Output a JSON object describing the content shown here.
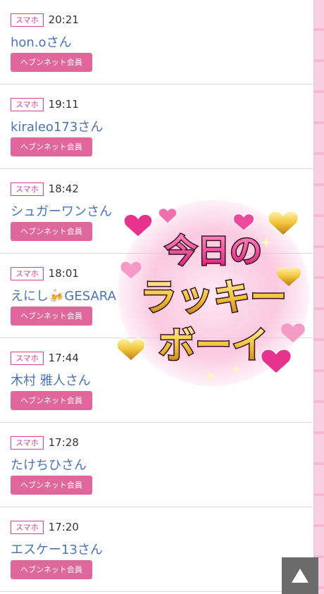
{
  "entries": [
    {
      "device": "スマホ",
      "time": "20:21",
      "name": "hon.oさん",
      "member_label": "ヘブンネット会員"
    },
    {
      "device": "スマホ",
      "time": "19:11",
      "name": "kiraleo173さん",
      "member_label": "ヘブンネット会員"
    },
    {
      "device": "スマホ",
      "time": "18:42",
      "name": "シュガーワンさん",
      "member_label": "ヘブンネット会員"
    },
    {
      "device": "スマホ",
      "time": "18:01",
      "name": "えにし🍻GESARA",
      "member_label": "ヘブンネット会員"
    },
    {
      "device": "スマホ",
      "time": "17:44",
      "name": "木村 雅人さん",
      "member_label": "ヘブンネット会員"
    },
    {
      "device": "スマホ",
      "time": "17:28",
      "name": "たけちひさん",
      "member_label": "ヘブンネット会員"
    },
    {
      "device": "スマホ",
      "time": "17:20",
      "name": "エスケー13さん",
      "member_label": "ヘブンネット会員"
    }
  ],
  "sticker": {
    "line1": "今日の",
    "line2": "ラッキー",
    "line3": "ボーイ"
  },
  "scroll_top": {
    "icon": "triangle-up-icon"
  },
  "colors": {
    "accent_pink": "#e0679b",
    "badge_pink": "#d6409a",
    "name_blue": "#4a74b9"
  }
}
